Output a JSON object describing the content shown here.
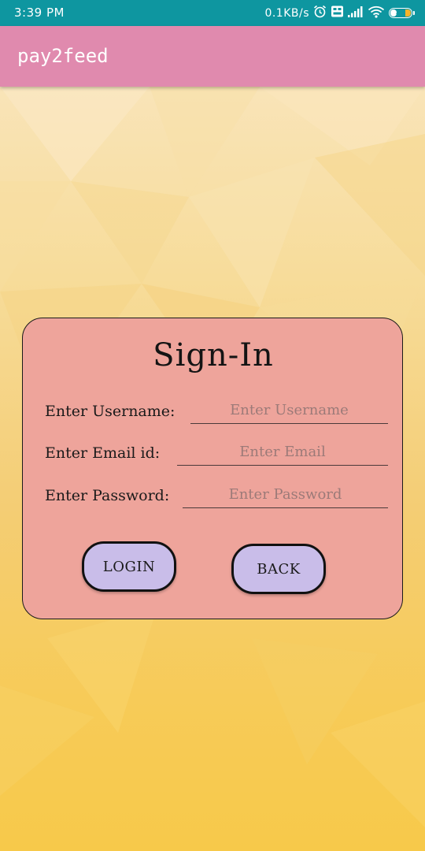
{
  "status_bar": {
    "time": "3:39 PM",
    "net_speed": "0.1KB/s",
    "battery_level": "29",
    "battery_fraction": 0.29,
    "icons": [
      "alarm-icon",
      "volte-icon",
      "signal-icon",
      "wifi-icon",
      "battery-icon"
    ]
  },
  "app_bar": {
    "title": "pay2feed"
  },
  "signin": {
    "title": "Sign-In",
    "username_label": "Enter Username:",
    "username_placeholder": "Enter Username",
    "email_label": "Enter Email id:",
    "email_placeholder": "Enter Email",
    "password_label": "Enter Password:",
    "password_placeholder": "Enter Password",
    "login_label": "LOGIN",
    "back_label": "BACK"
  },
  "colors": {
    "status_bar": "#0e96a0",
    "app_bar": "#e08aae",
    "card": "#eea49b",
    "button": "#c9bde9",
    "background_top": "#f9e2b4",
    "background_bottom": "#f7c94a"
  }
}
